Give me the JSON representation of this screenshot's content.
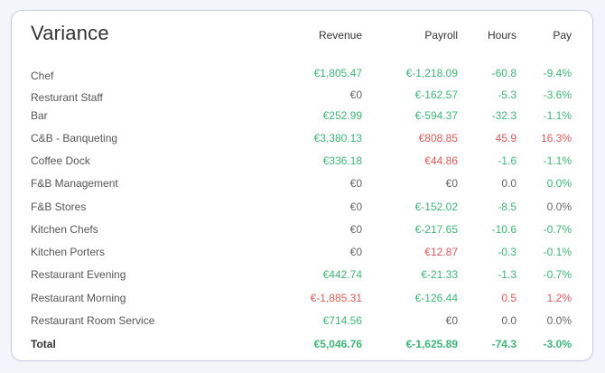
{
  "title": "Variance",
  "columns": {
    "revenue": "Revenue",
    "payroll": "Payroll",
    "hours": "Hours",
    "pay": "Pay"
  },
  "colors": {
    "positive": "#3cb878",
    "negative": "#e35a5a",
    "neutral": "#666666"
  },
  "rows": [
    {
      "name": "Chef",
      "revenue": "€1,805.47",
      "revenue_tone": "pos",
      "payroll": "€-1,218.09",
      "payroll_tone": "pos",
      "hours": "-60.8",
      "hours_tone": "pos",
      "pay": "-9.4%",
      "pay_tone": "pos"
    },
    {
      "name": "Resturant Staff",
      "revenue": "€0",
      "revenue_tone": "neu",
      "payroll": "€-162.57",
      "payroll_tone": "pos",
      "hours": "-5.3",
      "hours_tone": "pos",
      "pay": "-3.6%",
      "pay_tone": "pos"
    },
    {
      "name": "Bar",
      "revenue": "€252.99",
      "revenue_tone": "pos",
      "payroll": "€-594.37",
      "payroll_tone": "pos",
      "hours": "-32.3",
      "hours_tone": "pos",
      "pay": "-1.1%",
      "pay_tone": "pos"
    },
    {
      "name": "C&B - Banqueting",
      "revenue": "€3,380.13",
      "revenue_tone": "pos",
      "payroll": "€808.85",
      "payroll_tone": "neg",
      "hours": "45.9",
      "hours_tone": "neg",
      "pay": "16.3%",
      "pay_tone": "neg"
    },
    {
      "name": "Coffee Dock",
      "revenue": "€336.18",
      "revenue_tone": "pos",
      "payroll": "€44.86",
      "payroll_tone": "neg",
      "hours": "-1.6",
      "hours_tone": "pos",
      "pay": "-1.1%",
      "pay_tone": "pos"
    },
    {
      "name": "F&B Management",
      "revenue": "€0",
      "revenue_tone": "neu",
      "payroll": "€0",
      "payroll_tone": "neu",
      "hours": "0.0",
      "hours_tone": "neu",
      "pay": "0.0%",
      "pay_tone": "pos"
    },
    {
      "name": "F&B Stores",
      "revenue": "€0",
      "revenue_tone": "neu",
      "payroll": "€-152.02",
      "payroll_tone": "pos",
      "hours": "-8.5",
      "hours_tone": "pos",
      "pay": "0.0%",
      "pay_tone": "neu"
    },
    {
      "name": "Kitchen Chefs",
      "revenue": "€0",
      "revenue_tone": "neu",
      "payroll": "€-217.65",
      "payroll_tone": "pos",
      "hours": "-10.6",
      "hours_tone": "pos",
      "pay": "-0.7%",
      "pay_tone": "pos"
    },
    {
      "name": "Kitchen Porters",
      "revenue": "€0",
      "revenue_tone": "neu",
      "payroll": "€12.87",
      "payroll_tone": "neg",
      "hours": "-0.3",
      "hours_tone": "pos",
      "pay": "-0.1%",
      "pay_tone": "pos"
    },
    {
      "name": "Restaurant Evening",
      "revenue": "€442.74",
      "revenue_tone": "pos",
      "payroll": "€-21.33",
      "payroll_tone": "pos",
      "hours": "-1.3",
      "hours_tone": "pos",
      "pay": "-0.7%",
      "pay_tone": "pos"
    },
    {
      "name": "Restaurant Morning",
      "revenue": "€-1,885.31",
      "revenue_tone": "neg",
      "payroll": "€-126.44",
      "payroll_tone": "pos",
      "hours": "0.5",
      "hours_tone": "neg",
      "pay": "1.2%",
      "pay_tone": "neg"
    },
    {
      "name": "Restaurant Room Service",
      "revenue": "€714.56",
      "revenue_tone": "pos",
      "payroll": "€0",
      "payroll_tone": "neu",
      "hours": "0.0",
      "hours_tone": "neu",
      "pay": "0.0%",
      "pay_tone": "neu"
    }
  ],
  "total": {
    "name": "Total",
    "revenue": "€5,046.76",
    "revenue_tone": "pos",
    "payroll": "€-1,625.89",
    "payroll_tone": "pos",
    "hours": "-74.3",
    "hours_tone": "pos",
    "pay": "-3.0%",
    "pay_tone": "pos"
  }
}
